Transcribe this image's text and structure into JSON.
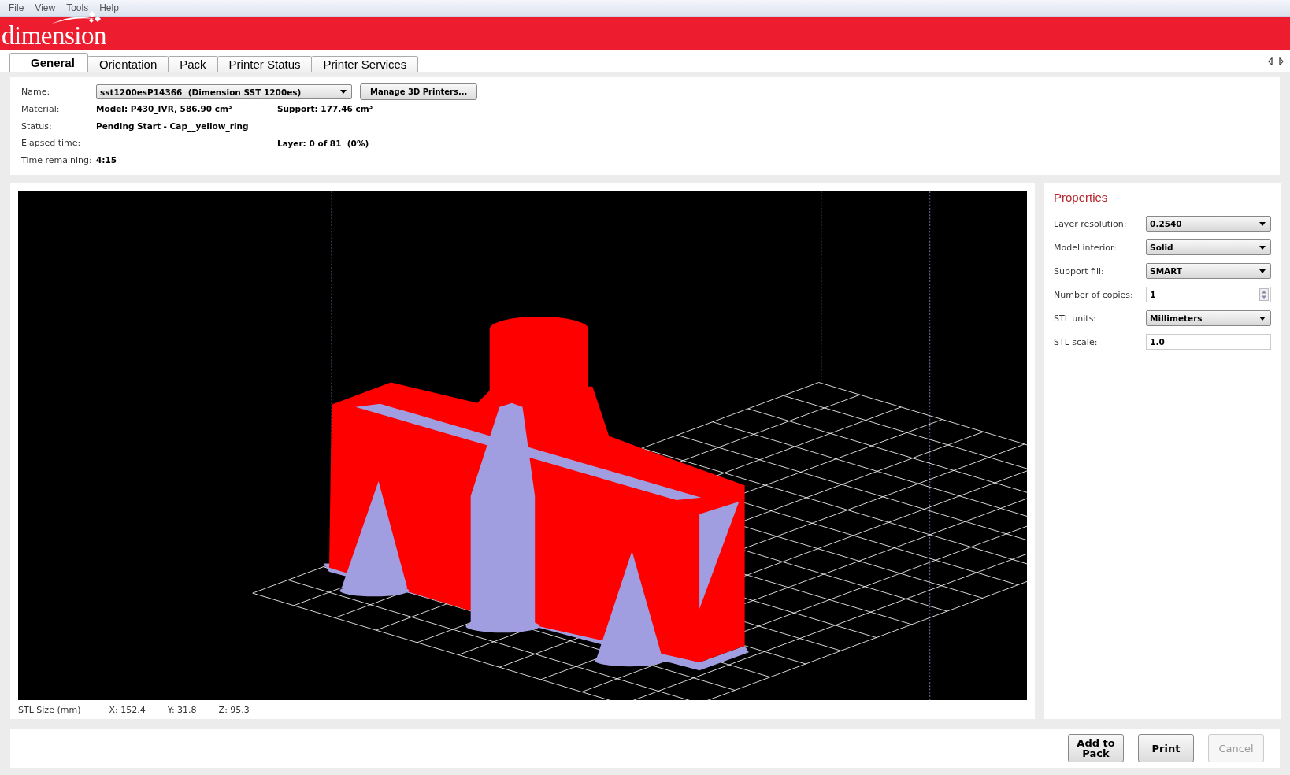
{
  "menu": [
    "File",
    "View",
    "Tools",
    "Help"
  ],
  "logo": {
    "text": "dimension"
  },
  "tabs": [
    {
      "label": "General",
      "selected": true
    },
    {
      "label": "Orientation",
      "selected": false
    },
    {
      "label": "Pack",
      "selected": false
    },
    {
      "label": "Printer Status",
      "selected": false
    },
    {
      "label": "Printer Services",
      "selected": false
    }
  ],
  "printer": {
    "rows": [
      {
        "label": "Name:",
        "kind": "select",
        "value": "sst1200esP14366  (Dimension SST 1200es)",
        "button": "Manage 3D Printers..."
      },
      {
        "label": "Material:",
        "kind": "text",
        "value": "Model: P430_IVR, 586.90 cm³",
        "extra": "Support: 177.46 cm³"
      },
      {
        "label": "Status:",
        "kind": "text",
        "value": "Pending Start - Cap__yellow_ring"
      },
      {
        "label": "Elapsed time:",
        "kind": "text",
        "extra": "Layer: 0 of 81  (0%)"
      },
      {
        "label": "Time remaining:",
        "kind": "text",
        "value": "4:15"
      }
    ]
  },
  "stl_size": {
    "label": "STL Size (mm)",
    "x": "X: 152.4",
    "y": "Y: 31.8",
    "z": "Z: 95.3"
  },
  "properties": {
    "title": "Properties",
    "rows": [
      {
        "label": "Layer resolution:",
        "kind": "select",
        "value": "0.2540"
      },
      {
        "label": "Model interior:",
        "kind": "select",
        "value": "Solid"
      },
      {
        "label": "Support fill:",
        "kind": "select",
        "value": "SMART"
      },
      {
        "label": "Number of copies:",
        "kind": "spinner",
        "value": "1"
      },
      {
        "label": "STL units:",
        "kind": "select",
        "value": "Millimeters"
      },
      {
        "label": "STL scale:",
        "kind": "input",
        "value": "1.0"
      }
    ]
  },
  "buttons": [
    {
      "label": "Add to Pack",
      "disabled": false
    },
    {
      "label": "Print",
      "disabled": false
    },
    {
      "label": "Cancel",
      "disabled": true
    }
  ]
}
